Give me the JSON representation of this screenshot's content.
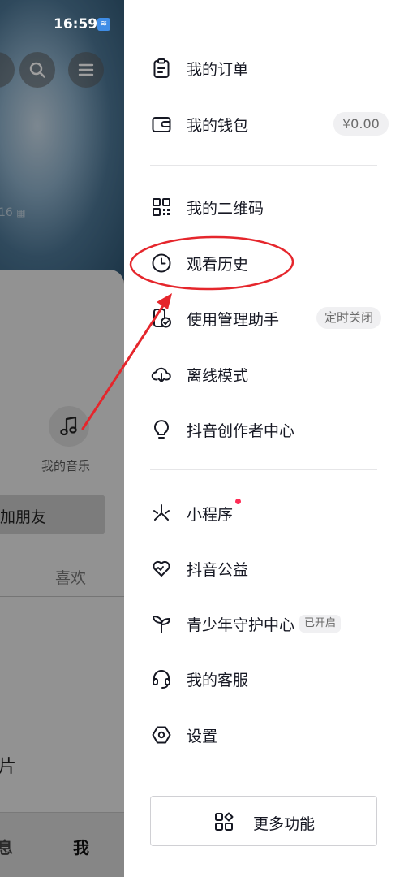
{
  "status_bar": {
    "time": "16:59"
  },
  "background_page": {
    "id_fragment": "16",
    "my_music_label": "我的音乐",
    "add_friend_label": "加朋友",
    "likes_tab_label": "喜欢",
    "pictures_fragment": "片",
    "messages_tab_fragment": "息",
    "me_tab_label": "我"
  },
  "drawer": {
    "items": [
      {
        "label": "我的订单",
        "icon": "clipboard-icon"
      },
      {
        "label": "我的钱包",
        "icon": "wallet-icon",
        "badge": "¥0.00"
      },
      {
        "label": "我的二维码",
        "icon": "qr-code-icon"
      },
      {
        "label": "观看历史",
        "icon": "clock-icon"
      },
      {
        "label": "使用管理助手",
        "icon": "phone-check-icon",
        "badge": "定时关闭"
      },
      {
        "label": "离线模式",
        "icon": "cloud-download-icon"
      },
      {
        "label": "抖音创作者中心",
        "icon": "lightbulb-icon"
      },
      {
        "label": "小程序",
        "icon": "mini-program-icon",
        "has_red_dot": true
      },
      {
        "label": "抖音公益",
        "icon": "heart-charity-icon"
      },
      {
        "label": "青少年守护中心",
        "icon": "sprout-icon",
        "badge": "已开启"
      },
      {
        "label": "我的客服",
        "icon": "headset-icon"
      },
      {
        "label": "设置",
        "icon": "hexagon-settings-icon"
      }
    ],
    "more_button": {
      "label": "更多功能",
      "icon": "grid-shapes-icon"
    }
  },
  "colors": {
    "annotation_red": "#e5262c",
    "notification_dot": "#fe2c55",
    "text_primary": "#161823"
  }
}
